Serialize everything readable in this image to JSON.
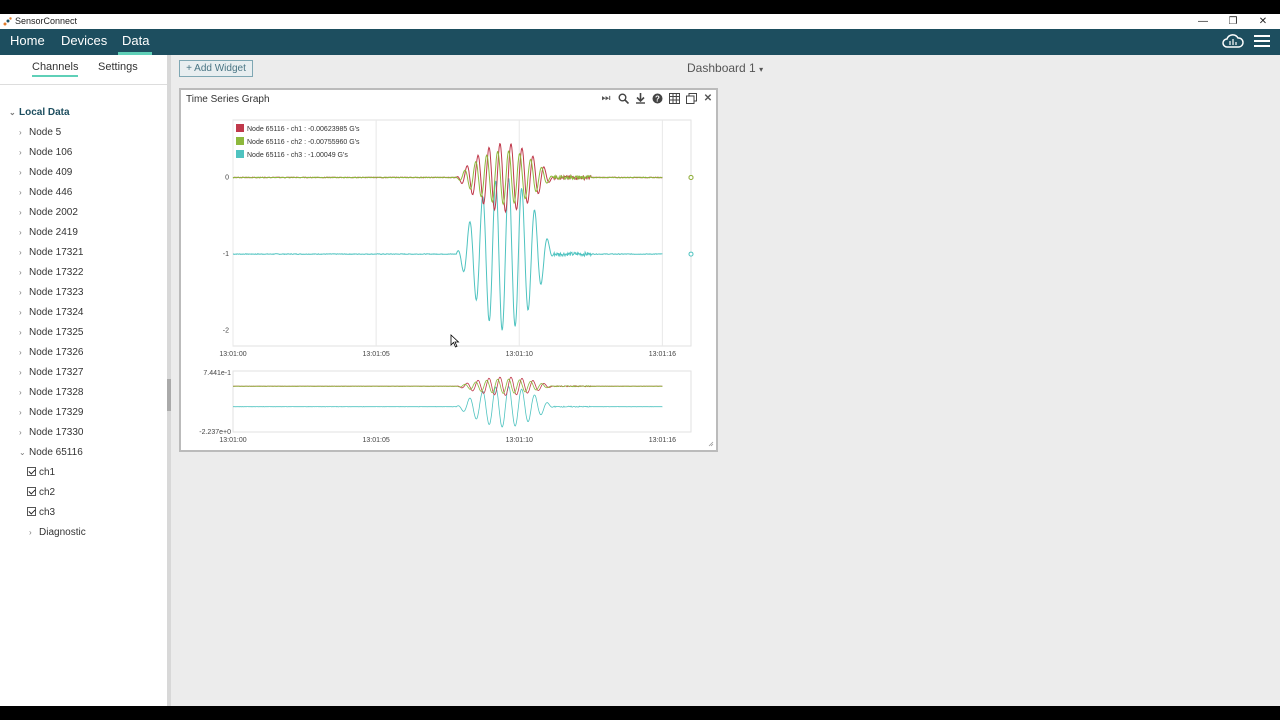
{
  "window": {
    "title": "SensorConnect",
    "minimize": "—",
    "restore": "❐",
    "close": "✕"
  },
  "nav": {
    "items": [
      "Home",
      "Devices",
      "Data"
    ],
    "active": "Data"
  },
  "sidebar": {
    "tabs": [
      "Channels",
      "Settings"
    ],
    "active_tab": "Channels",
    "root": "Local Data",
    "nodes": [
      "Node 5",
      "Node 106",
      "Node 409",
      "Node 446",
      "Node 2002",
      "Node 2419",
      "Node 17321",
      "Node 17322",
      "Node 17323",
      "Node 17324",
      "Node 17325",
      "Node 17326",
      "Node 17327",
      "Node 17328",
      "Node 17329",
      "Node 17330",
      "Node 65116"
    ],
    "expanded_node": "Node 65116",
    "channels": [
      {
        "label": "ch1",
        "checked": true
      },
      {
        "label": "ch2",
        "checked": true
      },
      {
        "label": "ch3",
        "checked": true
      }
    ],
    "diagnostic": "Diagnostic"
  },
  "toolbar": {
    "add_widget": "+ Add Widget",
    "dashboard": "Dashboard 1"
  },
  "widget": {
    "title": "Time Series Graph",
    "tools": [
      "skip-end-icon",
      "zoom-icon",
      "download-icon",
      "help-icon",
      "table-icon",
      "copy-icon",
      "close-icon"
    ]
  },
  "colors": {
    "nav_bg": "#1d4e5f",
    "accent": "#5fd0b8",
    "ch1": "#c0394b",
    "ch2": "#8db83c",
    "ch3": "#4fc3c0"
  },
  "chart_data": [
    {
      "type": "line",
      "legend": [
        "Node 65116 - ch1 : -0.00623985 G's",
        "Node 65116 - ch2 : -0.00755960 G's",
        "Node 65116 - ch3 : -1.00049 G's"
      ],
      "x_ticks": [
        "13:01:00",
        "13:01:05",
        "13:01:10",
        "13:01:16"
      ],
      "y_ticks": [
        "0",
        "-1",
        "-2"
      ],
      "xlim": [
        0,
        16
      ],
      "ylim": [
        -2.2,
        0.75
      ],
      "grid": "vertical",
      "legend_position": "top-left",
      "series": [
        {
          "name": "Node 65116 - ch1",
          "baseline": 0,
          "burst_start": 7.8,
          "burst_end": 11.2,
          "amplitude": 0.45
        },
        {
          "name": "Node 65116 - ch2",
          "baseline": 0,
          "burst_start": 7.8,
          "burst_end": 11.2,
          "amplitude": 0.35
        },
        {
          "name": "Node 65116 - ch3",
          "baseline": -1,
          "burst_start": 7.8,
          "burst_end": 11.2,
          "amplitude": 1.0
        }
      ]
    },
    {
      "type": "line",
      "x_ticks": [
        "13:01:00",
        "13:01:05",
        "13:01:10",
        "13:01:16"
      ],
      "y_ticks": [
        "7.441e-1",
        "-2.237e+0"
      ],
      "xlim": [
        0,
        16
      ],
      "ylim": [
        -2.237,
        0.7441
      ]
    }
  ]
}
